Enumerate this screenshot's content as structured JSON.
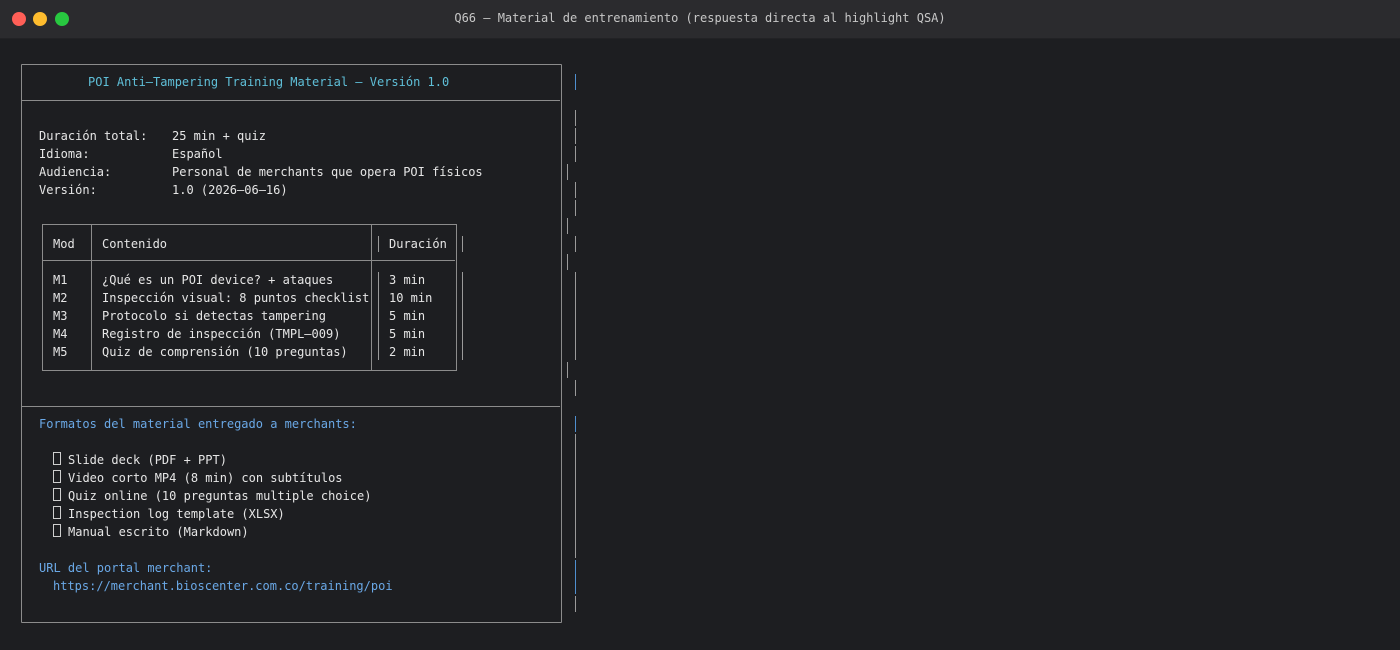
{
  "window": {
    "title": "Q66 — Material de entrenamiento (respuesta directa al highlight QSA)"
  },
  "doc": {
    "header": "POI Anti–Tampering Training Material — Versión 1.0",
    "meta": [
      {
        "key": "Duración total:",
        "value": "25 min + quiz"
      },
      {
        "key": "Idioma:",
        "value": "Español"
      },
      {
        "key": "Audiencia:",
        "value": "Personal de merchants que opera POI físicos"
      },
      {
        "key": "Versión:",
        "value": "1.0 (2026–06–16)"
      }
    ],
    "table": {
      "headers": [
        "Mod",
        "Contenido",
        "Duración"
      ],
      "rows": [
        [
          "M1",
          "¿Qué es un POI device? + ataques",
          "3 min"
        ],
        [
          "M2",
          "Inspección visual: 8 puntos checklist",
          "10 min"
        ],
        [
          "M3",
          "Protocolo si detectas tampering",
          "5 min"
        ],
        [
          "M4",
          "Registro de inspección (TMPL–009)",
          "5 min"
        ],
        [
          "M5",
          "Quiz de comprensión (10 preguntas)",
          "2 min"
        ]
      ]
    },
    "formats_title": "Formatos del material entregado a merchants:",
    "formats": [
      "Slide deck (PDF + PPT)",
      "Video corto MP4 (8 min) con subtítulos",
      "Quiz online (10 preguntas multiple choice)",
      "Inspection log template (XLSX)",
      "Manual escrito (Markdown)"
    ],
    "url_label": "URL del portal merchant:",
    "url": "https://merchant.bioscenter.com.co/training/poi"
  }
}
